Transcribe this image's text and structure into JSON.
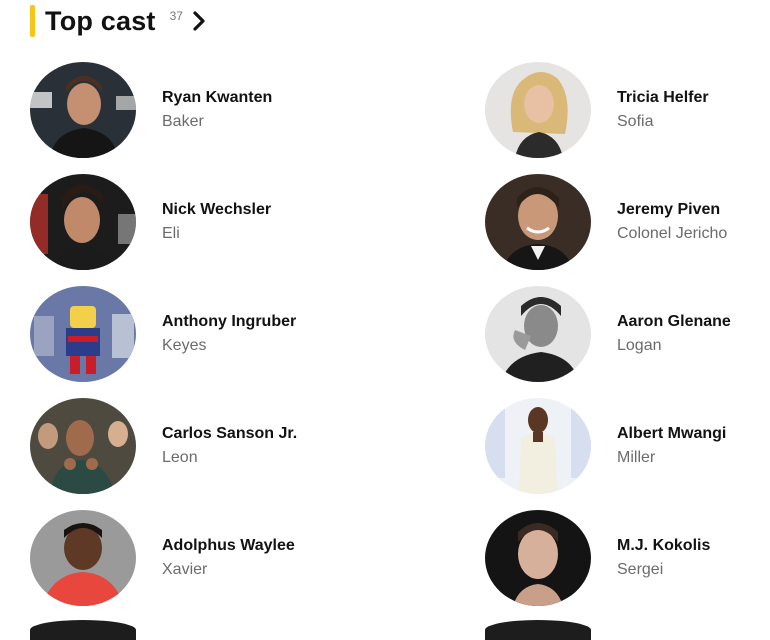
{
  "section": {
    "title": "Top cast",
    "count": "37",
    "accent_color": "#f5c518",
    "chevron_icon": "chevron-right-icon"
  },
  "cast": [
    {
      "actor": "Ryan Kwanten",
      "role": "Baker"
    },
    {
      "actor": "Tricia Helfer",
      "role": "Sofia"
    },
    {
      "actor": "Nick Wechsler",
      "role": "Eli"
    },
    {
      "actor": "Jeremy Piven",
      "role": "Colonel Jericho"
    },
    {
      "actor": "Anthony Ingruber",
      "role": "Keyes"
    },
    {
      "actor": "Aaron Glenane",
      "role": "Logan"
    },
    {
      "actor": "Carlos Sanson Jr.",
      "role": "Leon"
    },
    {
      "actor": "Albert Mwangi",
      "role": "Miller"
    },
    {
      "actor": "Adolphus Waylee",
      "role": "Xavier"
    },
    {
      "actor": "M.J. Kokolis",
      "role": "Sergei"
    }
  ]
}
